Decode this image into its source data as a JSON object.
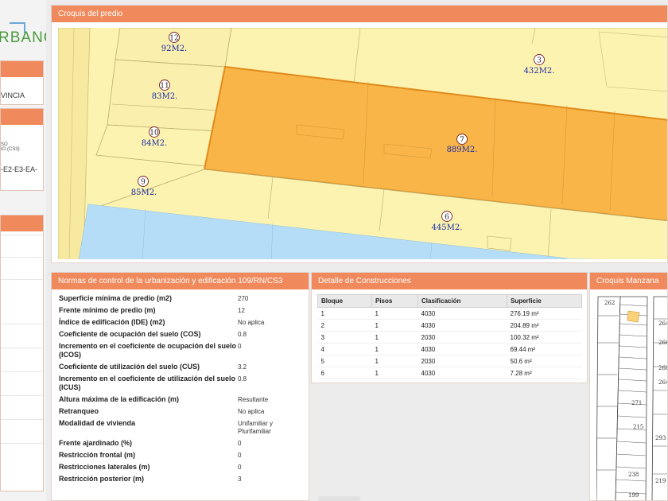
{
  "logo": {
    "text": "RBANO"
  },
  "left_cards": [
    {
      "text": "VINCIA"
    },
    {
      "line1": "SO",
      "line2": "IO (CS3)",
      "line3": "-E2-E3-EA-"
    }
  ],
  "croquis": {
    "title": "Croquis del predio",
    "lots": [
      {
        "num": "12",
        "area": "92M2."
      },
      {
        "num": "11",
        "area": "83M2."
      },
      {
        "num": "10",
        "area": "84M2."
      },
      {
        "num": "9",
        "area": "85M2."
      },
      {
        "num": "3",
        "area": "432M2."
      },
      {
        "num": "7",
        "area": "889M2."
      },
      {
        "num": "6",
        "area": "445M2."
      }
    ]
  },
  "normas": {
    "title": "Normas de control de la urbanización y edificación 109/RN/CS3",
    "rows": [
      {
        "label": "Superficie mínima de predio (m2)",
        "value": "270"
      },
      {
        "label": "Frente mínimo de predio (m)",
        "value": "12"
      },
      {
        "label": "Índice de edificación (IDE) (m2)",
        "value": "No aplica"
      },
      {
        "label": "Coeficiente de ocupación del suelo (COS)",
        "value": "0.8"
      },
      {
        "label": "Incremento en el coeficiente de ocupación del suelo (ICOS)",
        "value": "0"
      },
      {
        "label": "Coeficiente de utilización del suelo (CUS)",
        "value": "3.2"
      },
      {
        "label": "Incremento en el coeficiente de utilización del suelo (ICUS)",
        "value": "0.8"
      },
      {
        "label": "Altura máxima de la edificación (m)",
        "value": "Resultante"
      },
      {
        "label": "Retranqueo",
        "value": "No aplica"
      },
      {
        "label": "Modalidad de vivienda",
        "value": "Unifamiliar y Plurifamiliar"
      },
      {
        "label": "Frente ajardinado (%)",
        "value": "0"
      },
      {
        "label": "Restricción frontal (m)",
        "value": "0"
      },
      {
        "label": "Restricciones laterales (m)",
        "value": "0"
      },
      {
        "label": "Restricción posterior (m)",
        "value": "3"
      }
    ]
  },
  "detalle": {
    "title": "Detalle de Construcciones",
    "columns": [
      "Bloque",
      "Pisos",
      "Clasificación",
      "Superficie"
    ],
    "rows": [
      [
        "1",
        "1",
        "4030",
        "276.19 m²"
      ],
      [
        "2",
        "1",
        "4030",
        "204.89 m²"
      ],
      [
        "3",
        "1",
        "2030",
        "100.32 m²"
      ],
      [
        "4",
        "1",
        "4030",
        "69.44 m²"
      ],
      [
        "5",
        "1",
        "2030",
        "50.6 m²"
      ],
      [
        "6",
        "1",
        "4030",
        "7.28 m²"
      ]
    ]
  },
  "manzana": {
    "title": "Croquis Manzana",
    "labels": [
      "262",
      "264",
      "266",
      "268",
      "264",
      "271",
      "215",
      "293",
      "238",
      "219",
      "199"
    ]
  },
  "colors": {
    "accent": "#f08a5d",
    "lot_fill": "#fdf3b0",
    "selected_lot": "#f9b548",
    "street": "#b6ddf7"
  }
}
